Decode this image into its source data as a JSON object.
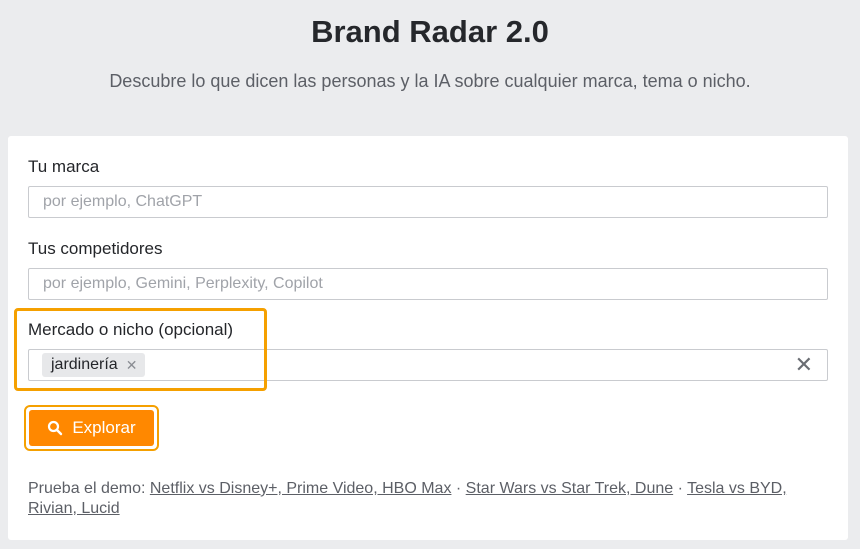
{
  "header": {
    "title": "Brand Radar 2.0",
    "subtitle": "Descubre lo que dicen las personas y la IA sobre cualquier marca, tema o nicho."
  },
  "form": {
    "brand": {
      "label": "Tu marca",
      "placeholder": "por ejemplo, ChatGPT",
      "value": ""
    },
    "competitors": {
      "label": "Tus competidores",
      "placeholder": "por ejemplo, Gemini, Perplexity, Copilot",
      "value": ""
    },
    "niche": {
      "label": "Mercado o nicho (opcional)",
      "chips": [
        "jardinería"
      ]
    },
    "explore_label": "Explorar"
  },
  "demo": {
    "prefix": "Prueba el demo:",
    "links": [
      "Netflix vs Disney+, Prime Video, HBO Max",
      "Star Wars vs Star Trek, Dune",
      "Tesla vs BYD, Rivian, Lucid"
    ],
    "separator": "·"
  },
  "colors": {
    "accent": "#ff8800",
    "highlight": "#f5a000",
    "background": "#ebecee"
  },
  "icons": {
    "explore": "search-icon",
    "chip_remove": "close-icon",
    "clear": "close-icon"
  }
}
